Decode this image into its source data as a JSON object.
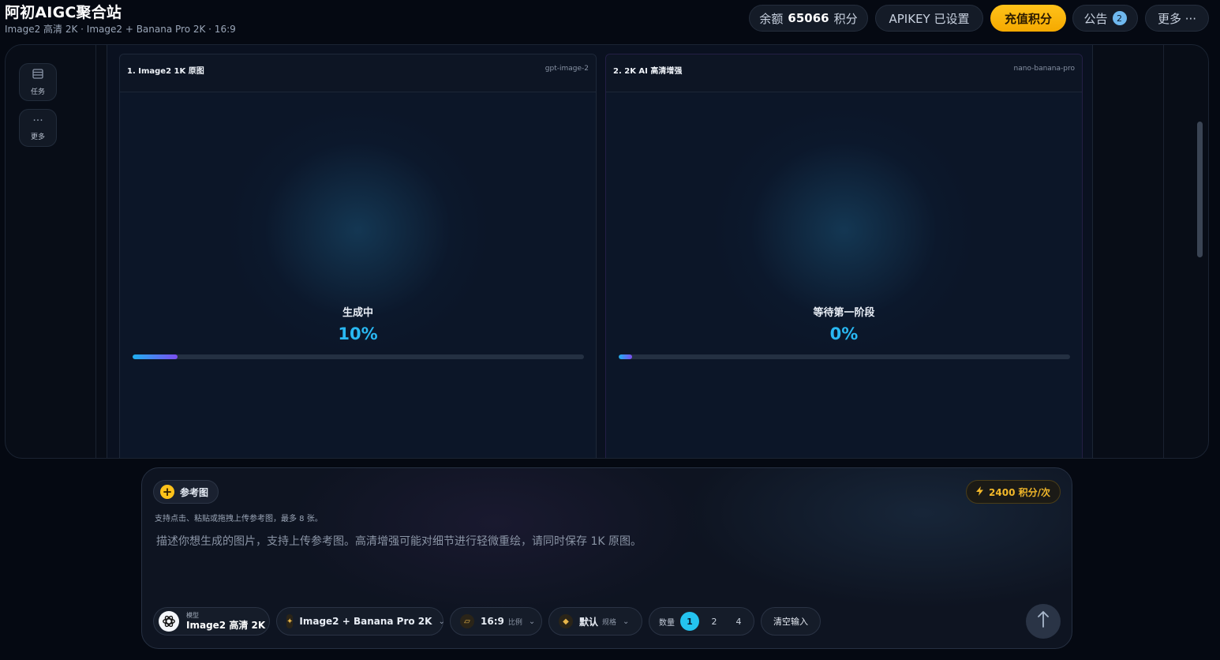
{
  "header": {
    "title": "阿初AIGC聚合站",
    "subtitle": "Image2 高清 2K · Image2 + Banana Pro 2K · 16:9",
    "balance_label": "余额",
    "balance_value": "65066",
    "balance_unit": "积分",
    "apikey_label": "APIKEY 已设置",
    "recharge_label": "充值积分",
    "notice_label": "公告",
    "notice_count": "2",
    "more_label": "更多 ···"
  },
  "sidebar": {
    "items": [
      {
        "label": "任务",
        "icon": "list-icon"
      },
      {
        "label": "更多",
        "icon": "ellipsis-icon"
      }
    ]
  },
  "cards": [
    {
      "title": "1. Image2 1K 原图",
      "model": "gpt-image-2",
      "status": "生成中",
      "percent_text": "10%",
      "progress": 0.1
    },
    {
      "title": "2. 2K AI 高清增强",
      "model": "nano-banana-pro",
      "status": "等待第一阶段",
      "percent_text": "0%",
      "progress": 0.03
    }
  ],
  "composer": {
    "ref_label": "参考图",
    "cost_label": "2400 积分/次",
    "hint": "支持点击、粘贴或拖拽上传参考图，最多 8 张。",
    "placeholder": "描述你想生成的图片，支持上传参考图。高清增强可能对细节进行轻微重绘，请同时保存 1K 原图。",
    "model_key": "模型",
    "model_value": "Image2 高清 2K",
    "pipeline_label": "Image2 + Banana Pro 2K",
    "ratio_value": "16:9",
    "ratio_key": "比例",
    "spec_value": "默认",
    "spec_key": "规格",
    "count_label": "数量",
    "count_options": [
      "1",
      "2",
      "4"
    ],
    "count_selected": "1",
    "clear_label": "清空输入"
  },
  "colors": {
    "accent": "#24c3ef",
    "recharge": "#ffc21a",
    "progress_start": "#1fb0f0",
    "progress_end": "#7c4df0"
  }
}
